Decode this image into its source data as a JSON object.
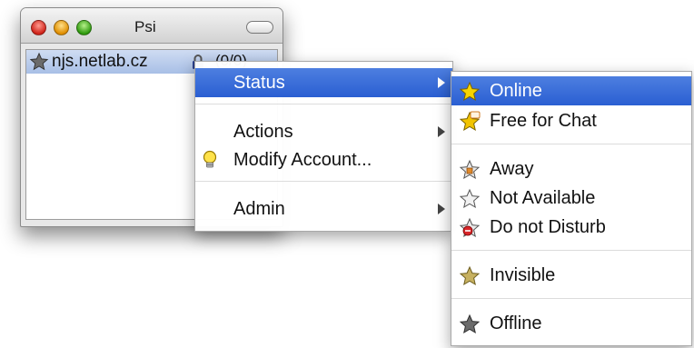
{
  "window": {
    "title": "Psi"
  },
  "roster": {
    "account": "njs.netlab.cz",
    "count": "(0/0)"
  },
  "context_menu": {
    "items": [
      {
        "label": "Status",
        "has_submenu": true,
        "selected": true
      },
      {
        "label": "Actions",
        "has_submenu": true
      },
      {
        "label": "Modify Account...",
        "icon": "bulb-icon"
      },
      {
        "label": "Admin",
        "has_submenu": true
      }
    ]
  },
  "status_menu": {
    "items": [
      {
        "label": "Online",
        "icon": "star-online-icon",
        "selected": true
      },
      {
        "label": "Free for Chat",
        "icon": "star-chat-icon"
      },
      {
        "label": "Away",
        "icon": "star-away-icon"
      },
      {
        "label": "Not Available",
        "icon": "star-na-icon"
      },
      {
        "label": "Do not Disturb",
        "icon": "star-dnd-icon"
      },
      {
        "label": "Invisible",
        "icon": "star-invisible-icon"
      },
      {
        "label": "Offline",
        "icon": "star-offline-icon"
      }
    ]
  },
  "colors": {
    "selection": "#3a6fdc",
    "online_star": "#f5d000"
  }
}
